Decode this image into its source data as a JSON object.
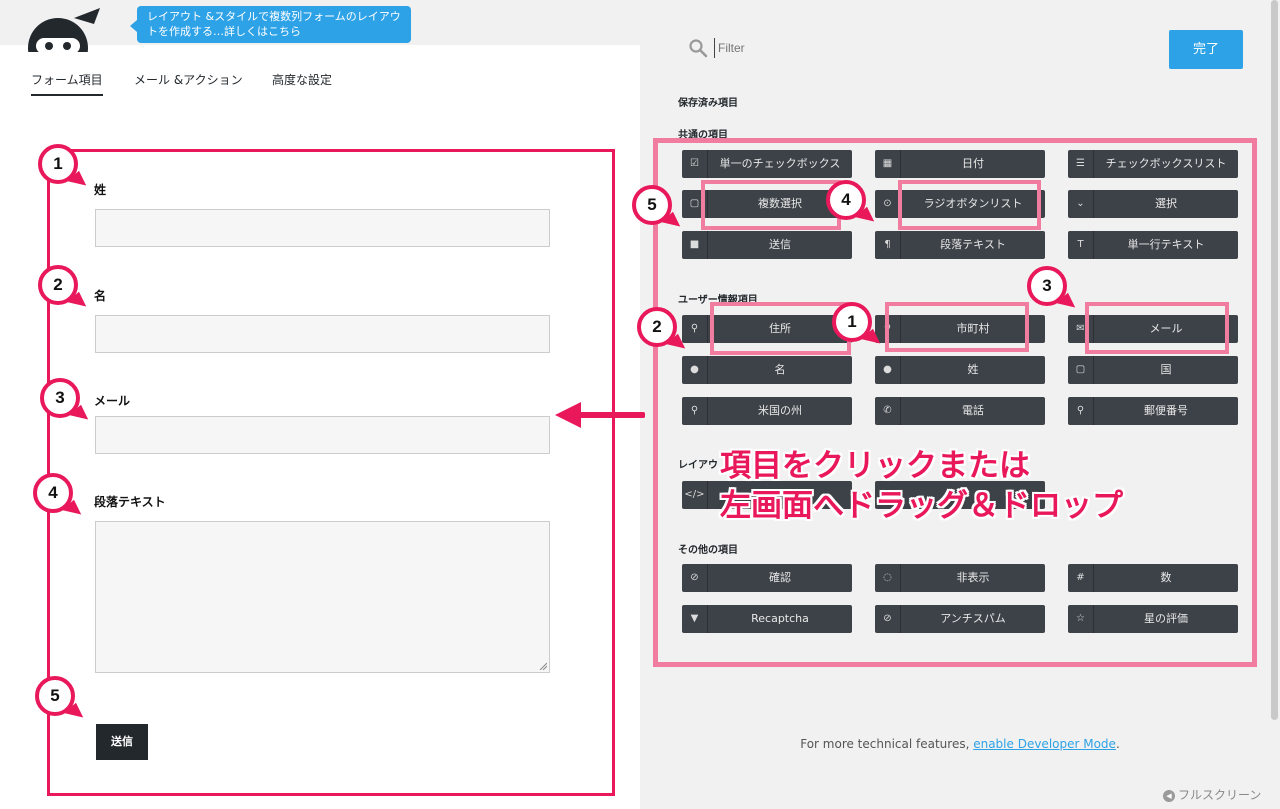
{
  "header": {
    "tooltip_text": "レイアウト &スタイルで複数列フォームのレイアウトを作成する…詳しくはこちら",
    "tabs": [
      {
        "label": "フォーム項目",
        "active": true
      },
      {
        "label": "メール &アクション",
        "active": false
      },
      {
        "label": "高度な設定",
        "active": false
      }
    ]
  },
  "form": {
    "fields": [
      {
        "label": "姓"
      },
      {
        "label": "名"
      },
      {
        "label": "メール"
      },
      {
        "label": "段落テキスト"
      }
    ],
    "submit_label": "送信"
  },
  "callouts": [
    "1",
    "2",
    "3",
    "4",
    "5"
  ],
  "sidebar": {
    "filter_placeholder": "Filter",
    "done_label": "完了",
    "saved_title": "保存済み項目",
    "sections": [
      {
        "title": "共通の項目",
        "items": [
          {
            "label": "単一のチェックボックス",
            "icon": "☑"
          },
          {
            "label": "日付",
            "icon": "▦"
          },
          {
            "label": "チェックボックスリスト",
            "icon": "☰"
          },
          {
            "label": "複数選択",
            "icon": "▢"
          },
          {
            "label": "ラジオボタンリスト",
            "icon": "⊙"
          },
          {
            "label": "選択",
            "icon": "⌄"
          },
          {
            "label": "送信",
            "icon": "■"
          },
          {
            "label": "段落テキスト",
            "icon": "¶"
          },
          {
            "label": "単一行テキスト",
            "icon": "T"
          }
        ]
      },
      {
        "title": "ユーザー情報項目",
        "items": [
          {
            "label": "住所",
            "icon": "⚲"
          },
          {
            "label": "市町村",
            "icon": "⚲"
          },
          {
            "label": "メール",
            "icon": "✉"
          },
          {
            "label": "名",
            "icon": "●"
          },
          {
            "label": "姓",
            "icon": "●"
          },
          {
            "label": "国",
            "icon": "▢"
          },
          {
            "label": "米国の州",
            "icon": "⚲"
          },
          {
            "label": "電話",
            "icon": "✆"
          },
          {
            "label": "郵便番号",
            "icon": "⚲"
          }
        ]
      },
      {
        "title": "レイアウ",
        "items": [
          {
            "label": "",
            "icon": "</>"
          }
        ]
      },
      {
        "title": "その他の項目",
        "items": [
          {
            "label": "確認",
            "icon": "⊘"
          },
          {
            "label": "非表示",
            "icon": "◌"
          },
          {
            "label": "数",
            "icon": "#"
          },
          {
            "label": "Recaptcha",
            "icon": "▼"
          },
          {
            "label": "アンチスパム",
            "icon": "⊘"
          },
          {
            "label": "星の評価",
            "icon": "☆"
          }
        ]
      }
    ]
  },
  "overlay": {
    "line1": "項目をクリックまたは",
    "line2": "左画面へドラッグ＆ドロップ"
  },
  "footer": {
    "note_prefix": "For more technical features, ",
    "note_link": "enable Developer Mode",
    "note_suffix": ".",
    "fullscreen_label": "フルスクリーン"
  },
  "colors": {
    "accent_blue": "#2ea2e6",
    "callout_red": "#e8185b",
    "highlight_pink": "#f07ca0",
    "field_button_bg": "#3d4248"
  }
}
